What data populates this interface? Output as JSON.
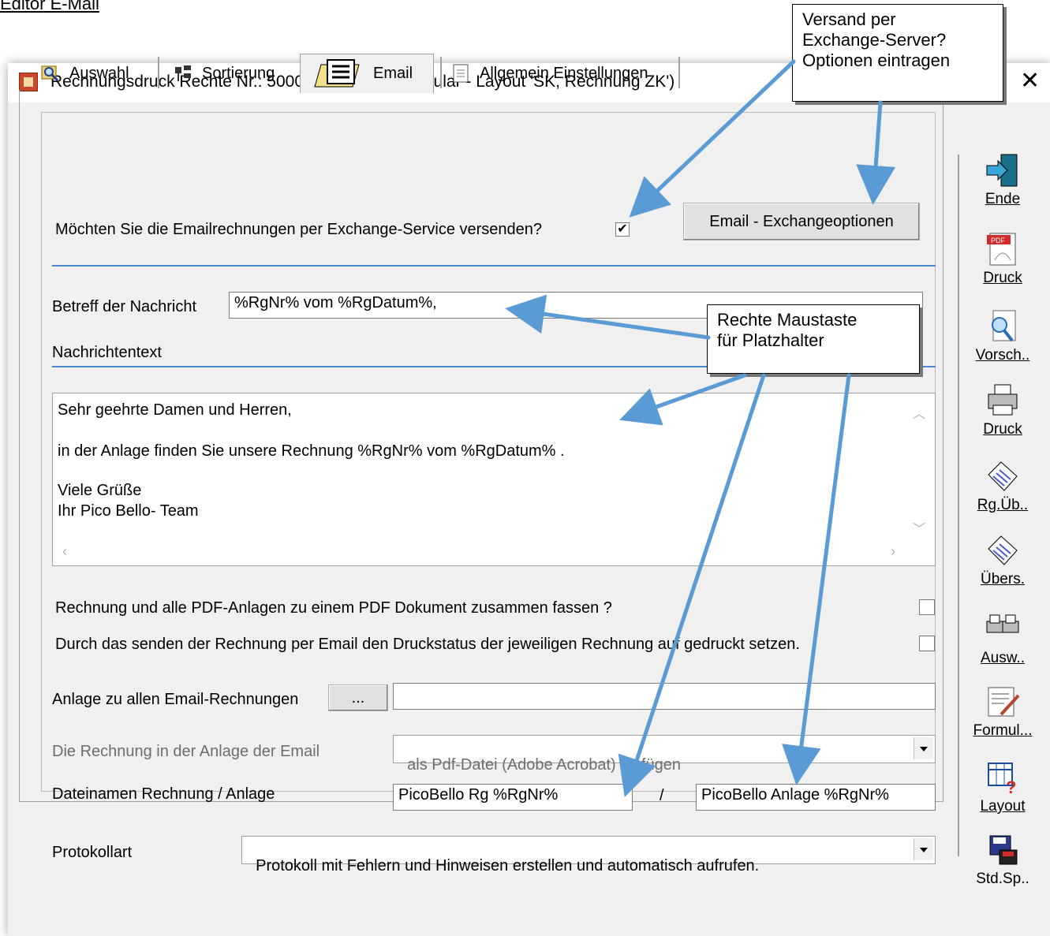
{
  "page": {
    "heading": "Editor E-Mail"
  },
  "window": {
    "title": "Rechnungsdruck Rechte Nr.: 50004    (Aktives Formular - Layout 'SK, Rechnung ZK')",
    "close_glyph": "✕"
  },
  "tabs": [
    {
      "label": "Auswahl",
      "icon": "search-list-icon"
    },
    {
      "label": "Sortierung",
      "icon": "sort-icon"
    },
    {
      "label": "Email",
      "icon": "email-form-icon",
      "active": true
    },
    {
      "label": "Allgemein Einstellungen",
      "icon": "document-icon"
    }
  ],
  "exchange": {
    "question": "Möchten Sie die Emailrechnungen per Exchange-Service versenden?",
    "checked": true,
    "check_glyph": "✔",
    "options_button": "Email - Exchangeoptionen"
  },
  "subject": {
    "label": "Betreff der Nachricht",
    "value": "%RgNr% vom %RgDatum%,"
  },
  "message": {
    "label": "Nachrichtentext",
    "lines": [
      "Sehr geehrte Damen und Herren,",
      "in der Anlage finden Sie unsere Rechnung %RgNr% vom %RgDatum% .",
      "Viele Grüße",
      "Ihr Pico Bello- Team"
    ]
  },
  "options": {
    "combine_pdf": "Rechnung und alle PDF-Anlagen zu einem PDF Dokument zusammen fassen ?",
    "combine_pdf_checked": false,
    "set_printed": "Durch das senden der Rechnung per Email den Druckstatus der jeweiligen Rechnung auf gedruckt setzen.",
    "set_printed_checked": false
  },
  "attachment": {
    "label": "Anlage zu allen Email-Rechnungen",
    "browse_button": "...",
    "value": ""
  },
  "invoice_attachment": {
    "label": "Die Rechnung in der Anlage der Email",
    "selected": "als Pdf-Datei (Adobe Acrobat) einfügen"
  },
  "filenames": {
    "label": "Dateinamen Rechnung / Anlage",
    "invoice": "PicoBello Rg %RgNr%",
    "separator": "/",
    "attachment": "PicoBello Anlage %RgNr%"
  },
  "protocol": {
    "label": "Protokollart",
    "selected": "Protokoll mit Fehlern und Hinweisen erstellen und automatisch aufrufen."
  },
  "sidebar": [
    {
      "label": "Ende",
      "icon": "exit-door-icon"
    },
    {
      "label": "Druck",
      "icon": "pdf-icon"
    },
    {
      "label": "Vorsch..",
      "icon": "preview-icon"
    },
    {
      "label": "Druck",
      "icon": "printer-icon"
    },
    {
      "label": "Rg.Üb..",
      "icon": "invoice-overview-icon"
    },
    {
      "label": "Übers.",
      "icon": "overview-icon"
    },
    {
      "label": "Ausw..",
      "icon": "double-printer-icon"
    },
    {
      "label": "Formul...",
      "icon": "form-edit-icon"
    },
    {
      "label": "Layout",
      "icon": "layout-help-icon"
    },
    {
      "label": "Std.Sp..",
      "icon": "standard-save-icon"
    }
  ],
  "callouts": {
    "exchange": "Versand per\nExchange-Server?\nOptionen eintragen",
    "placeholder": "Rechte Maustaste\nfür Platzhalter"
  },
  "colors": {
    "accent_line": "#4a8ad4",
    "arrow": "#5b9bd5"
  }
}
